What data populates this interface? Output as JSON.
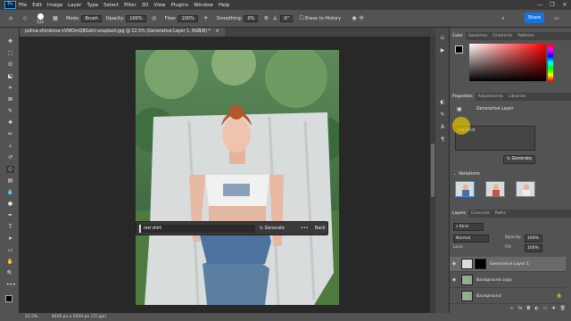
{
  "menubar": {
    "logo": "Ps",
    "items": [
      "File",
      "Edit",
      "Image",
      "Layer",
      "Type",
      "Select",
      "Filter",
      "3D",
      "View",
      "Plugins",
      "Window",
      "Help"
    ],
    "window_controls": [
      "—",
      "❐",
      "✕"
    ]
  },
  "options": {
    "size_value": "122",
    "mode_label": "Mode:",
    "mode_value": "Brush",
    "opacity_label": "Opacity:",
    "opacity_value": "100%",
    "flow_label": "Flow:",
    "flow_value": "100%",
    "smoothing_label": "Smoothing:",
    "smoothing_value": "0%",
    "angle_value": "0°",
    "erase_history_label": "Erase to History",
    "share_label": "Share"
  },
  "document": {
    "tab_title": "polina-shirokova-nVWOmQ8GatU-unsplash.jpg @ 12.5% (Generative Layer 1, RGB/8) *",
    "close": "×"
  },
  "generative_bar": {
    "prompt": "red shirt",
    "generate_label": "Generate",
    "more_label": "•••",
    "back_label": "Back"
  },
  "color_panel": {
    "tabs": [
      "Color",
      "Swatches",
      "Gradients",
      "Patterns"
    ]
  },
  "properties_panel": {
    "tabs": [
      "Properties",
      "Adjustments",
      "Libraries"
    ],
    "layer_type": "Generative Layer",
    "prompt_value": "red shirt",
    "generate_label": "Generate",
    "variations_label": "Variations"
  },
  "layers_panel": {
    "tabs": [
      "Layers",
      "Channels",
      "Paths"
    ],
    "kind_label": "Kind",
    "blend_mode": "Normal",
    "opacity_label": "Opacity:",
    "opacity_value": "100%",
    "lock_label": "Lock:",
    "fill_label": "Fill:",
    "fill_value": "100%",
    "layers": [
      {
        "name": "Generative Layer 1",
        "selected": true,
        "italic": false
      },
      {
        "name": "Background copy",
        "selected": false,
        "italic": false
      },
      {
        "name": "Background",
        "selected": false,
        "italic": true
      }
    ]
  },
  "status": {
    "zoom": "12.5%",
    "doc_info": "4016 px x 5020 px (72 ppi)"
  },
  "colors": {
    "accent": "#1473e6",
    "panel_bg": "#535353",
    "canvas_bg": "#282828",
    "cursor_highlight": "#e8c400"
  }
}
